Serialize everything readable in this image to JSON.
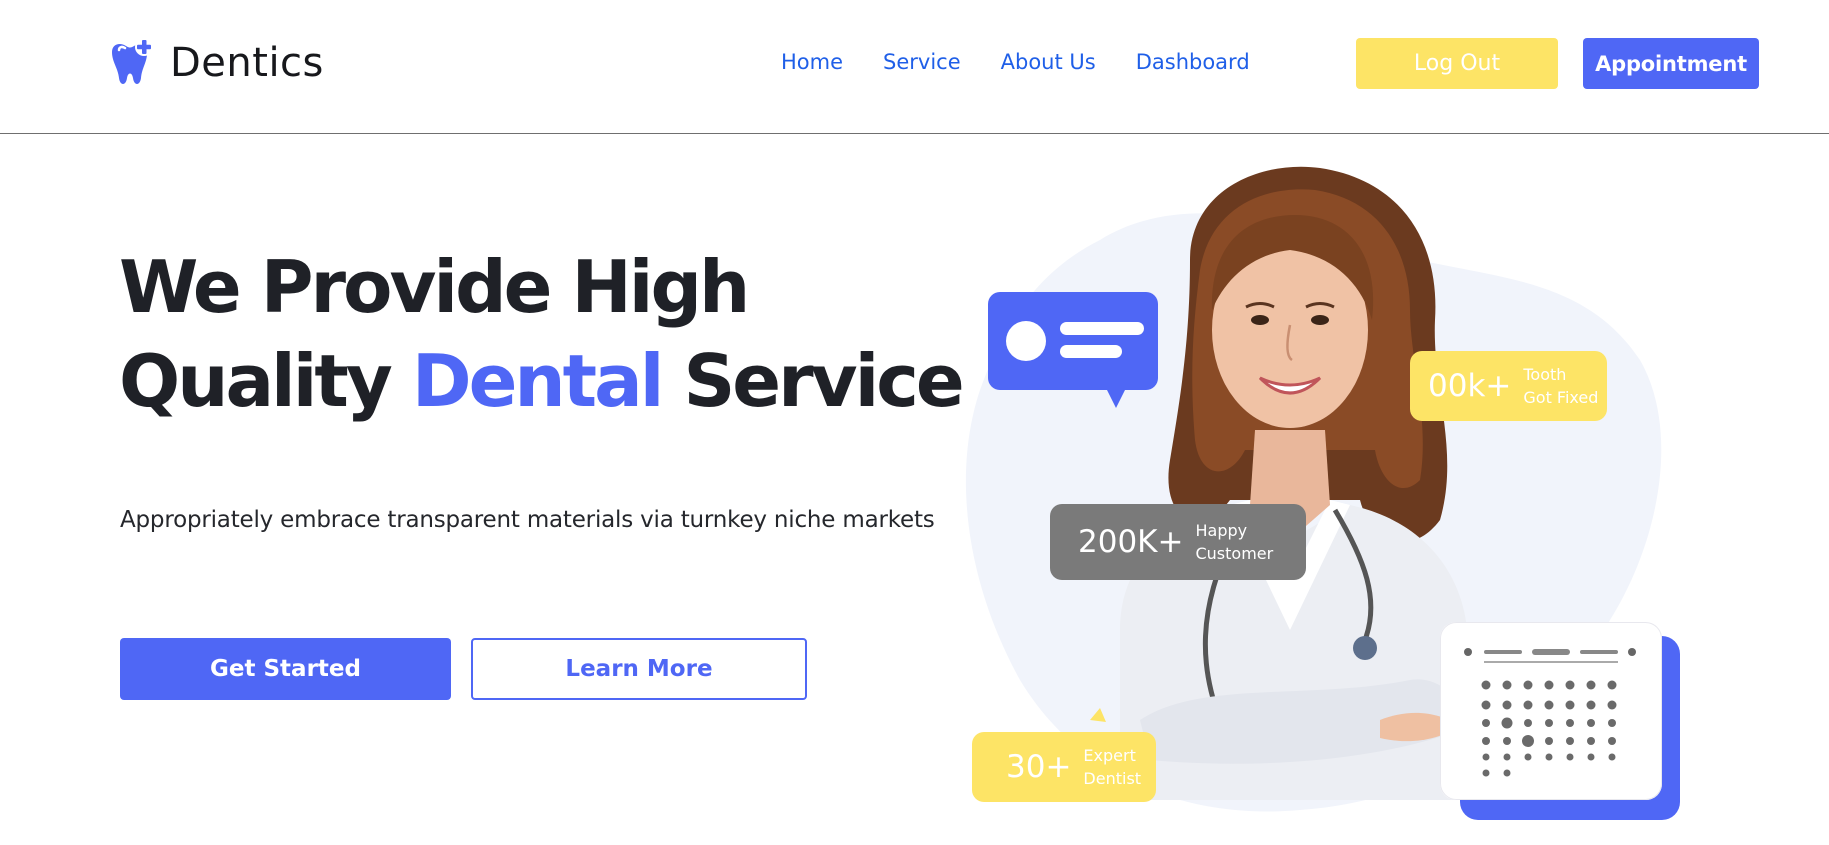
{
  "brand": {
    "name": "Dentics",
    "accent": "#4f67f5",
    "yellow": "#fde466"
  },
  "nav": {
    "links": [
      "Home",
      "Service",
      "About Us",
      "Dashboard"
    ],
    "logout_label": "Log Out",
    "appointment_label": "Appointment"
  },
  "hero": {
    "title_line1": "We Provide High",
    "title_line2_pre": "Quality ",
    "title_line2_accent": "Dental",
    "title_line2_post": " Service",
    "subtitle": "Appropriately embrace transparent materials via turnkey niche markets",
    "primary_button": "Get Started",
    "secondary_button": "Learn More"
  },
  "stats": {
    "tooth": {
      "value": "00k+",
      "label_line1": "Tooth",
      "label_line2": "Got Fixed"
    },
    "happy": {
      "value": "200K+",
      "label_line1": "Happy",
      "label_line2": "Customer"
    },
    "expert": {
      "value": "30+",
      "label_line1": "Expert",
      "label_line2": "Dentist"
    }
  },
  "icons": {
    "logo": "tooth-plus-icon",
    "chat": "chat-bubble-icon",
    "calendar": "calendar-icon"
  }
}
